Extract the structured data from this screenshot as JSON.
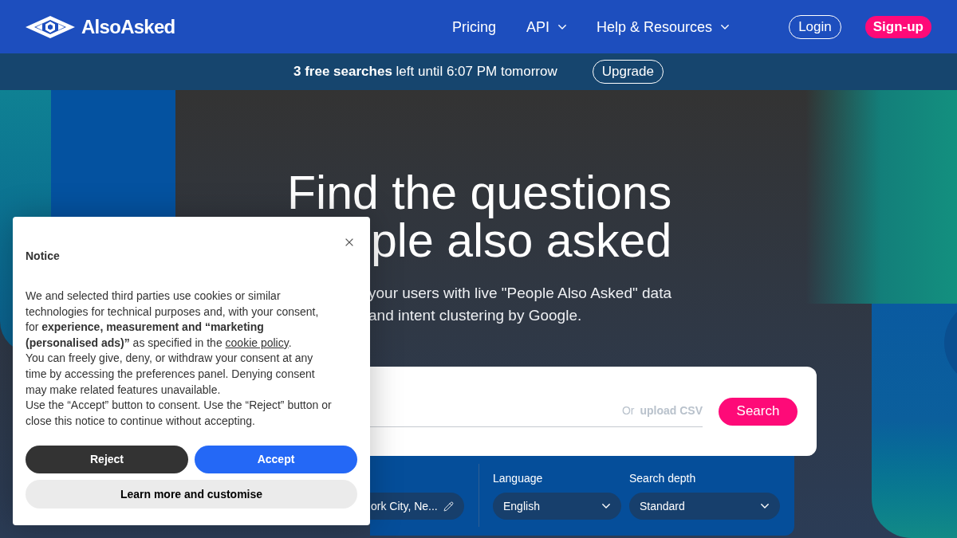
{
  "header": {
    "brand": "AlsoAsked",
    "nav": [
      {
        "label": "Pricing",
        "dropdown": false
      },
      {
        "label": "API",
        "dropdown": true
      },
      {
        "label": "Help & Resources",
        "dropdown": true
      }
    ],
    "login": "Login",
    "signup": "Sign-up"
  },
  "announcement": {
    "text": "**3 free searches** left until 6:07 PM tomorrow",
    "button": "Upgrade"
  },
  "hero": {
    "heading_lines": [
      "Find the questions",
      "ple also asked"
    ],
    "subtitle_lines": [
      "your users with live \"People Also Asked\" data",
      "and intent clustering by Google."
    ]
  },
  "search": {
    "or_text": "Or",
    "upload_link": "upload CSV",
    "button": "Search"
  },
  "options": [
    {
      "kind": "location",
      "value": "ork City, Ne..."
    },
    {
      "kind": "select",
      "label": "Language",
      "value": "English"
    },
    {
      "kind": "select",
      "label": "Search depth",
      "value": "Standard"
    }
  ],
  "notice": {
    "title": "Notice",
    "paragraphs": [
      {
        "kind": "linked",
        "before": "We and selected third parties use cookies or similar technologies for technical purposes and, with your consent, for **experience, measurement and “marketing (personalised ads)”** as specified in the",
        "link": "cookie policy",
        "after": "."
      },
      {
        "kind": "plain",
        "text": "You can freely give, deny, or withdraw your consent at any time by accessing the preferences panel. Denying consent may make related features unavailable."
      },
      {
        "kind": "plain",
        "text": "Use the “Accept” button to consent. Use the “Reject” button or close this notice to continue without accepting."
      }
    ],
    "buttons": [
      {
        "label": "Reject",
        "kind": "dark"
      },
      {
        "label": "Accept",
        "kind": "primary"
      },
      {
        "label": "Learn more and customise",
        "kind": "light"
      }
    ]
  }
}
